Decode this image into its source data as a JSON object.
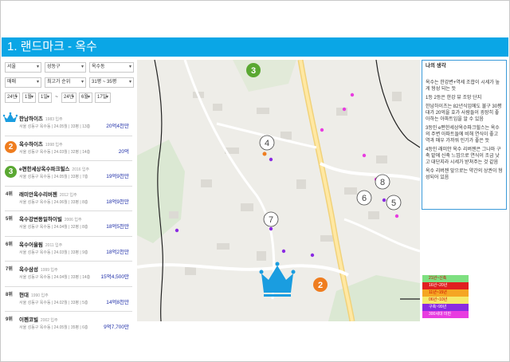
{
  "header": {
    "title": "1. 랜드마크 - 옥수"
  },
  "filters": {
    "row1": [
      "서울",
      "성동구",
      "옥수동"
    ],
    "row2": [
      "매매",
      "최고가 순위",
      "31평 ~ 35평"
    ],
    "row3": [
      "24년",
      "1월",
      "1일",
      "~",
      "24년",
      "6월",
      "17일"
    ]
  },
  "ranking": [
    {
      "rank": "1",
      "name": "한남하이츠",
      "year": "1983 입주",
      "sub": "서울 성동구 옥수동 | 24.05월 | 33평 | 13층",
      "price": "20억4천만"
    },
    {
      "rank": "2",
      "name": "옥수하이츠",
      "year": "1998 입주",
      "sub": "서울 성동구 옥수동 | 24.03월 | 32평 | 14층",
      "price": "20억"
    },
    {
      "rank": "3",
      "name": "e편한세상옥수파크힐스",
      "year": "2016 입주",
      "sub": "서울 성동구 옥수동 | 24.05월 | 33평 | 7층",
      "price": "19억9천만"
    },
    {
      "rank": "4위",
      "name": "래미안옥수리버젠",
      "year": "2012 입주",
      "sub": "서울 성동구 옥수동 | 24.06월 | 33평 | 8층",
      "price": "18억9천만"
    },
    {
      "rank": "5위",
      "name": "옥수강변동일하이빌",
      "year": "2006 입주",
      "sub": "서울 성동구 옥수동 | 24.04월 | 32평 | 8층",
      "price": "18억5천만"
    },
    {
      "rank": "6위",
      "name": "옥수어울림",
      "year": "2011 입주",
      "sub": "서울 성동구 옥수동 | 24.03월 | 33평 | 9층",
      "price": "18억2천만"
    },
    {
      "rank": "7위",
      "name": "옥수삼성",
      "year": "1999 입주",
      "sub": "서울 성동구 옥수동 | 24.04월 | 33평 | 14층",
      "price": "15억4,500만"
    },
    {
      "rank": "8위",
      "name": "현대",
      "year": "1990 입주",
      "sub": "서울 성동구 옥수동 | 24.02월 | 33평 | 5층",
      "price": "14억8천만"
    },
    {
      "rank": "9위",
      "name": "이펜코빌",
      "year": "2002 입주",
      "sub": "서울 성동구 옥수동 | 24.05월 | 35평 | 6층",
      "price": "9억7,700만"
    }
  ],
  "map_markers": [
    "3",
    "4",
    "8",
    "7",
    "6",
    "5",
    "2"
  ],
  "note": {
    "title": "나의 생각",
    "paragraphs": [
      "옥수는 한강변+역세 조합이 시세가 높게 형성 되는 듯",
      "1등 2등은 한강 뷰 조망 단지",
      "한남하이츠는 82년식임에도 불구 30평대가 20억을 호가 사람들이 굉장히 좋아하는 아파트임을 알 수 있음",
      "3등인 e편한세상옥수파크힐스는 옥수의 주변 아파트들에 비해 연식이 좋고 역과 매우 가까워 인기가 좋은 듯",
      "4등인 래미안 옥수 리버젠은 그나마 구축 밭에 신축 느낌으로 연식이 조금 낫고 대단지라 시세가 받쳐주는 것 같음",
      "옥수 리버젠 앞으로는 약간의 상권이 형성되어 있음"
    ]
  },
  "legend": [
    {
      "label": "21년~신축",
      "color": "#7ee081"
    },
    {
      "label": "16년~20년",
      "color": "#e02020"
    },
    {
      "label": "11년~15년",
      "color": "#f5a623"
    },
    {
      "label": "06년~10년",
      "color": "#f5e96a"
    },
    {
      "label": "구축~99년",
      "color": "#8a2be2"
    },
    {
      "label": "300세대 미만",
      "color": "#e83ce0"
    }
  ],
  "colors": {
    "header": "#0aa6e6",
    "price": "#1e2ea8",
    "marker_green": "#5aa832",
    "marker_orange": "#ef7d1f",
    "crown": "#1a9de0"
  }
}
